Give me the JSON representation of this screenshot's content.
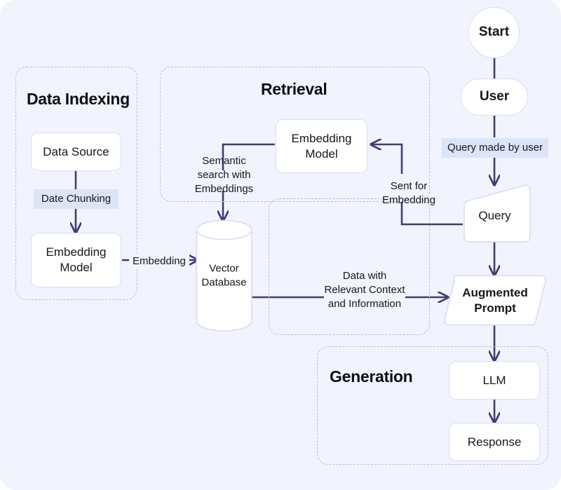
{
  "diagram": {
    "title": "RAG pipeline flowchart",
    "canvas_bg": "#f1f4fd",
    "accent_line": "#413c73",
    "node_border": "#dadbf7",
    "group_border": "#b9bed4",
    "highlight_bg": "#dde4f8"
  },
  "groups": [
    {
      "id": "data-indexing",
      "label": "Data Indexing"
    },
    {
      "id": "retrieval",
      "label": "Retrieval"
    },
    {
      "id": "retrieval-inner",
      "label": ""
    },
    {
      "id": "generation",
      "label": "Generation"
    }
  ],
  "nodes": {
    "data_source": "Data Source",
    "embedding_model_index": "Embedding\nModel",
    "embedding_model_retrieval": "Embedding\nModel",
    "vector_database": "Vector\nDatabase",
    "start": "Start",
    "user": "User",
    "query": "Query",
    "augmented_prompt": "Augmented\nPrompt",
    "llm": "LLM",
    "response": "Response"
  },
  "edge_labels": {
    "date_chunking": "Date Chunking",
    "embedding": "Embedding",
    "semantic_search": "Semantic\nsearch with\nEmbeddings",
    "sent_for_embedding": "Sent for\nEmbedding",
    "query_made_by_user": "Query made by user",
    "data_with_context": "Data with\nRelevant Context\nand Information"
  },
  "flow": [
    {
      "from": "data_source",
      "to": "embedding_model_index",
      "label": "Date Chunking"
    },
    {
      "from": "embedding_model_index",
      "to": "vector_database",
      "label": "Embedding"
    },
    {
      "from": "embedding_model_retrieval",
      "to": "vector_database",
      "label": "Semantic search with Embeddings"
    },
    {
      "from": "query",
      "to": "embedding_model_retrieval",
      "label": "Sent for Embedding"
    },
    {
      "from": "start",
      "to": "user",
      "label": ""
    },
    {
      "from": "user",
      "to": "query",
      "label": "Query made by user"
    },
    {
      "from": "vector_database",
      "to": "augmented_prompt",
      "label": "Data with Relevant Context and Information"
    },
    {
      "from": "query",
      "to": "augmented_prompt",
      "label": ""
    },
    {
      "from": "augmented_prompt",
      "to": "llm",
      "label": ""
    },
    {
      "from": "llm",
      "to": "response",
      "label": ""
    }
  ]
}
